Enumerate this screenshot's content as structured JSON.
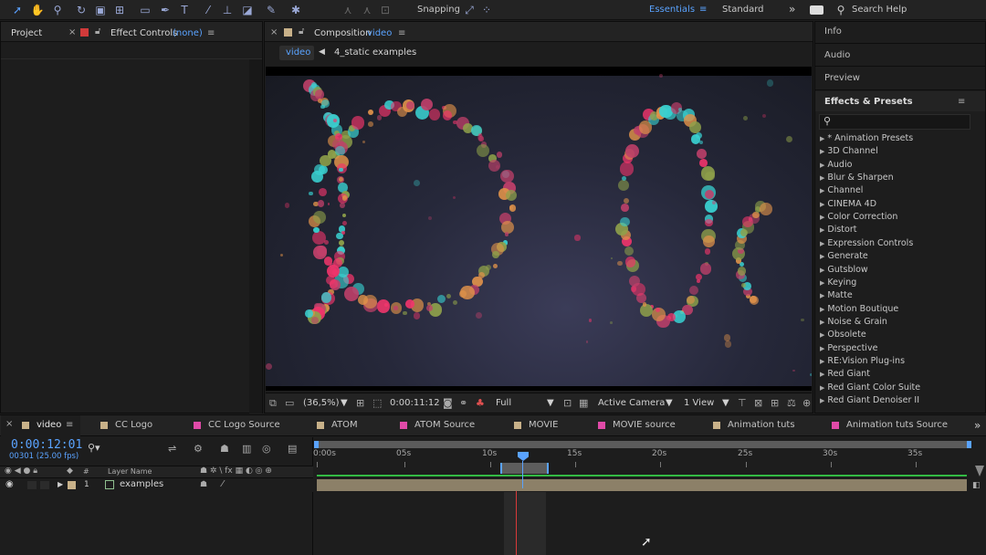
{
  "toolbar": {
    "tools": [
      "selection-tool",
      "hand-tool",
      "zoom-tool",
      "rotate-tool",
      "camera-tool",
      "pan-behind-tool",
      "rectangle-tool",
      "pen-tool",
      "type-tool",
      "brush-tool",
      "clone-stamp-tool",
      "eraser-tool",
      "roto-brush-tool",
      "puppet-tool"
    ],
    "snapping_label": "Snapping",
    "workspace_active": "Essentials",
    "workspace_other": "Standard",
    "search_help": "Search Help"
  },
  "left_panel": {
    "project_tab": "Project",
    "effect_controls_tab": "Effect Controls",
    "effect_controls_target": "(none)"
  },
  "composition_panel": {
    "tab_label": "Composition",
    "comp_name": "video",
    "breadcrumb_active": "video",
    "breadcrumb_other": "4_static examples"
  },
  "viewer_bar": {
    "magnification": "(36,5%)",
    "timecode": "0:00:11:12",
    "resolution": "Full",
    "camera": "Active Camera",
    "views": "1 View"
  },
  "right_panel": {
    "info": "Info",
    "audio": "Audio",
    "preview": "Preview",
    "effects_presets": "Effects & Presets",
    "effect_categories": [
      "* Animation Presets",
      "3D Channel",
      "Audio",
      "Blur & Sharpen",
      "Channel",
      "CINEMA 4D",
      "Color Correction",
      "Distort",
      "Expression Controls",
      "Generate",
      "Gutsblow",
      "Keying",
      "Matte",
      "Motion Boutique",
      "Noise & Grain",
      "Obsolete",
      "Perspective",
      "RE:Vision Plug-ins",
      "Red Giant",
      "Red Giant Color Suite",
      "Red Giant Denoiser II"
    ]
  },
  "timeline_tabs": [
    {
      "label": "video",
      "color": "#c8b189"
    },
    {
      "label": "CC Logo",
      "color": "#c8b189"
    },
    {
      "label": "CC Logo Source",
      "color": "#e04aa8"
    },
    {
      "label": "ATOM",
      "color": "#c8b189"
    },
    {
      "label": "ATOM Source",
      "color": "#e04aa8"
    },
    {
      "label": "MOVIE",
      "color": "#c8b189"
    },
    {
      "label": "MOVIE source",
      "color": "#e04aa8"
    },
    {
      "label": "Animation tuts",
      "color": "#c8b189"
    },
    {
      "label": "Animation tuts Source",
      "color": "#e04aa8"
    }
  ],
  "timeline": {
    "current_time": "0:00:12:01",
    "frame_info": "00301 (25.00 fps)",
    "layer_name_header": "Layer Name",
    "layer_index": "1",
    "layer_name": "examples",
    "ruler_labels": [
      "0:00s",
      "05s",
      "10s",
      "15s",
      "20s",
      "25s",
      "30s",
      "35s"
    ]
  },
  "colors": {
    "accent": "#5aa3ff",
    "layer_bar": "#8c8068",
    "work_area": "#5d5d5d",
    "playhead": "#5aa3ff",
    "current_time_indicator": "#d83a3a"
  }
}
